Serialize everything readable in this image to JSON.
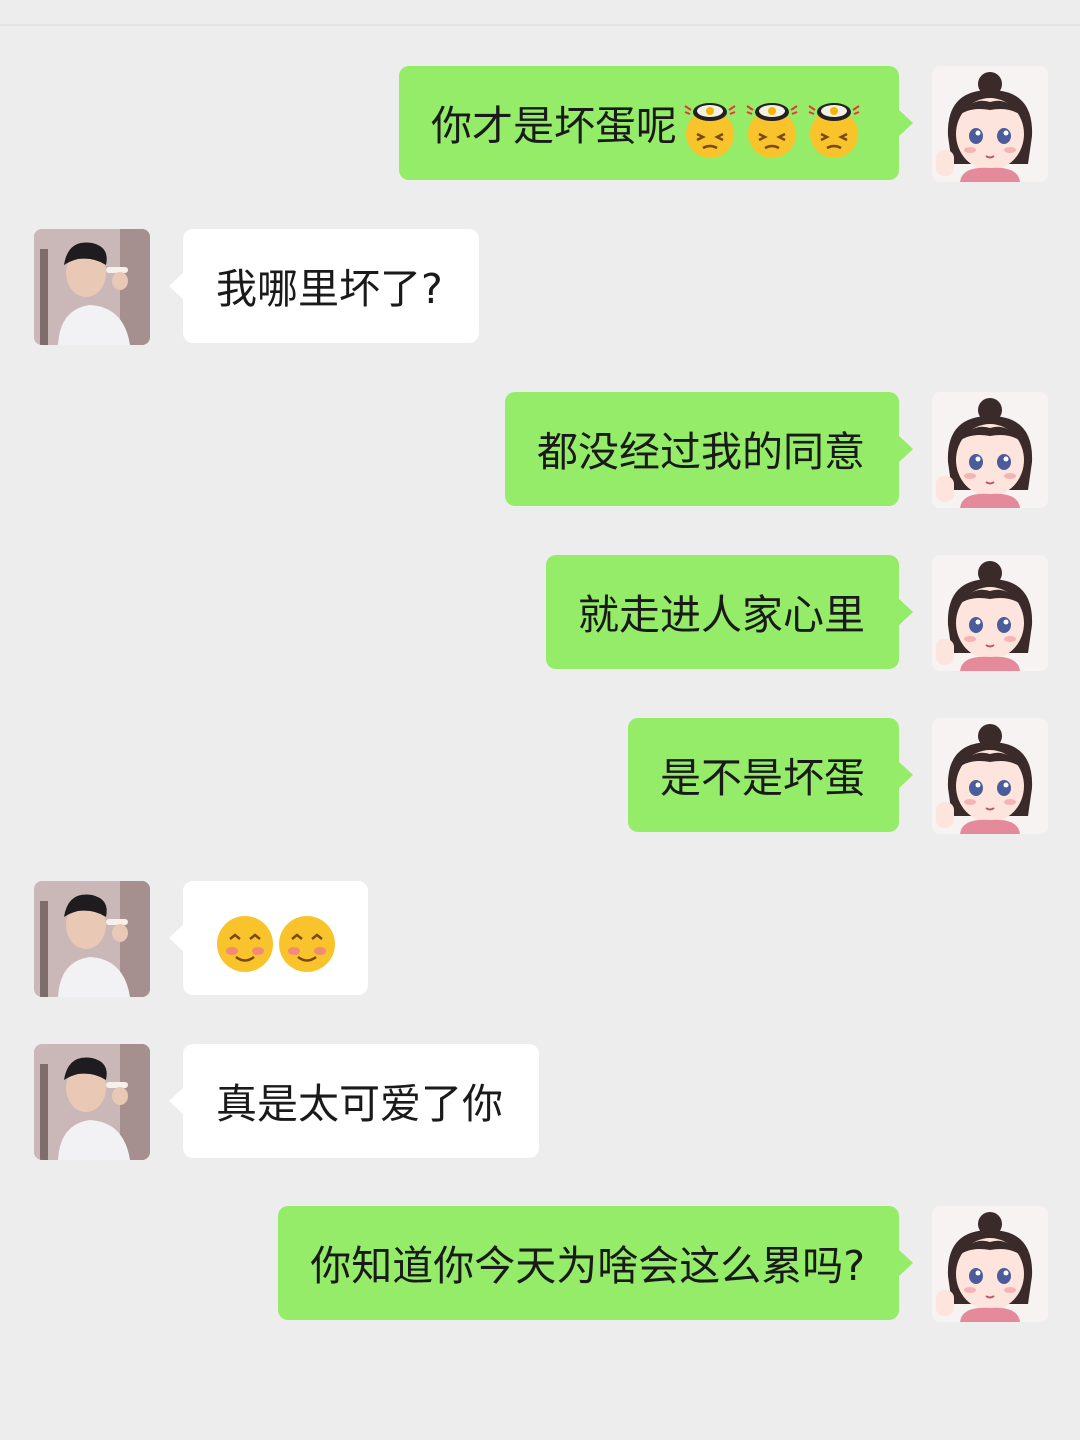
{
  "chat": {
    "messages": [
      {
        "sender": "me",
        "text": "你才是坏蛋呢",
        "emojis": [
          "fried-egg-face-emoji",
          "fried-egg-face-emoji",
          "fried-egg-face-emoji"
        ]
      },
      {
        "sender": "other",
        "text": "我哪里坏了?",
        "emojis": []
      },
      {
        "sender": "me",
        "text": "都没经过我的同意",
        "emojis": []
      },
      {
        "sender": "me",
        "text": "就走进人家心里",
        "emojis": []
      },
      {
        "sender": "me",
        "text": "是不是坏蛋",
        "emojis": []
      },
      {
        "sender": "other",
        "text": "",
        "emojis": [
          "shy-smile-emoji",
          "shy-smile-emoji"
        ]
      },
      {
        "sender": "other",
        "text": "真是太可爱了你",
        "emojis": []
      },
      {
        "sender": "me",
        "text": "你知道你今天为啥会这么累吗?",
        "emojis": []
      }
    ]
  },
  "colors": {
    "background": "#ededed",
    "my_bubble": "#95ec69",
    "other_bubble": "#ffffff"
  },
  "icons": {
    "my_avatar": "cartoon-girl-avatar",
    "other_avatar": "young-man-photo-avatar"
  }
}
